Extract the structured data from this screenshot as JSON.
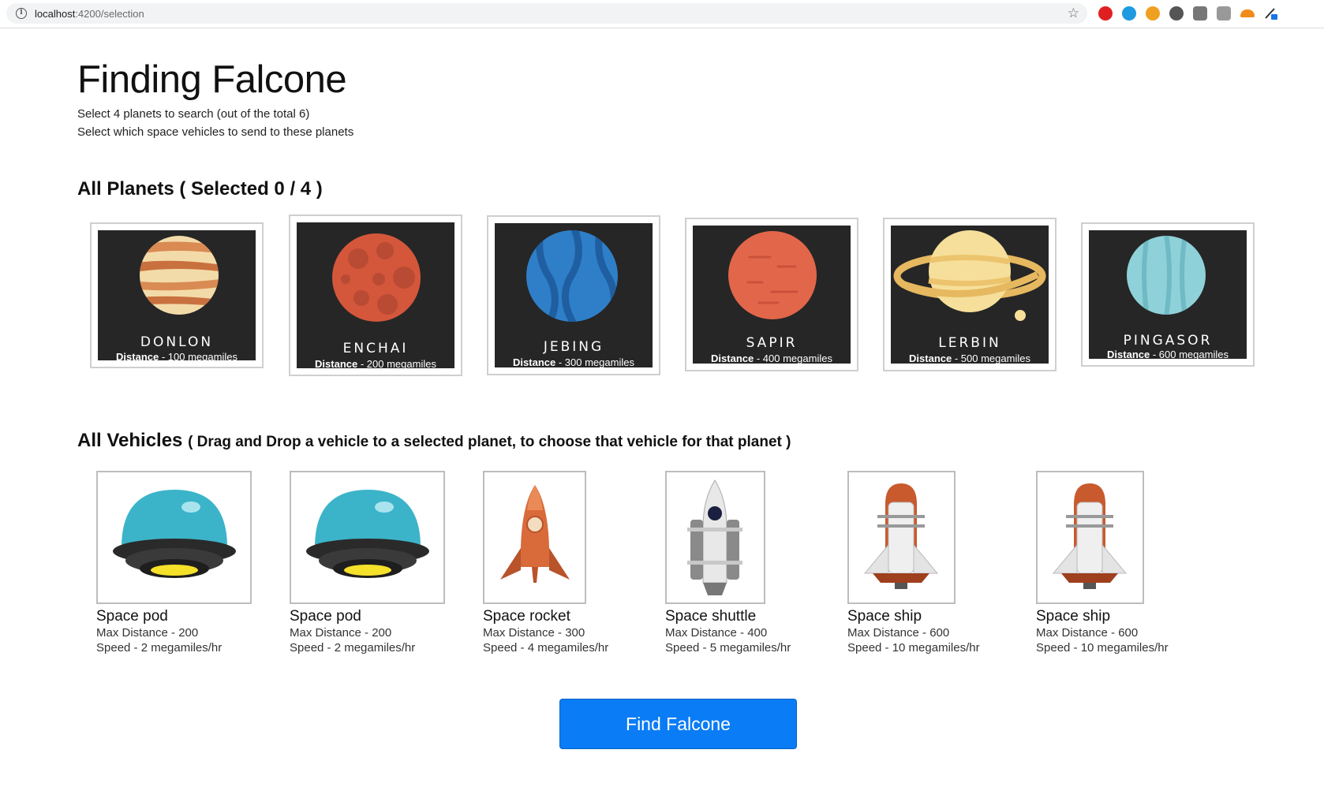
{
  "browser": {
    "url_host": "localhost",
    "url_rest": ":4200/selection"
  },
  "header": {
    "title": "Finding Falcone",
    "subtitle_1": "Select 4 planets to search (out of the total 6)",
    "subtitle_2": "Select which space vehicles to send to these planets"
  },
  "planets_section": {
    "heading": "All Planets ( Selected 0 / 4 )",
    "planets": [
      {
        "name": "DONLON",
        "distance_label": "Distance",
        "distance_value": "- 100 megamiles"
      },
      {
        "name": "ENCHAI",
        "distance_label": "Distance",
        "distance_value": "- 200 megamiles"
      },
      {
        "name": "JEBING",
        "distance_label": "Distance",
        "distance_value": "- 300 megamiles"
      },
      {
        "name": "SAPIR",
        "distance_label": "Distance",
        "distance_value": "- 400 megamiles"
      },
      {
        "name": "LERBIN",
        "distance_label": "Distance",
        "distance_value": "- 500 megamiles"
      },
      {
        "name": "PINGASOR",
        "distance_label": "Distance",
        "distance_value": "- 600 megamiles"
      }
    ]
  },
  "vehicles_section": {
    "heading": "All Vehicles",
    "hint": "( Drag and Drop a vehicle to a selected planet, to choose that vehicle for that planet )",
    "vehicles": [
      {
        "name": "Space pod",
        "max_distance": "Max Distance - 200",
        "speed": "Speed - 2 megamiles/hr"
      },
      {
        "name": "Space pod",
        "max_distance": "Max Distance - 200",
        "speed": "Speed - 2 megamiles/hr"
      },
      {
        "name": "Space rocket",
        "max_distance": "Max Distance - 300",
        "speed": "Speed - 4 megamiles/hr"
      },
      {
        "name": "Space shuttle",
        "max_distance": "Max Distance - 400",
        "speed": "Speed - 5 megamiles/hr"
      },
      {
        "name": "Space ship",
        "max_distance": "Max Distance - 600",
        "speed": "Speed - 10 megamiles/hr"
      },
      {
        "name": "Space ship",
        "max_distance": "Max Distance - 600",
        "speed": "Speed - 10 megamiles/hr"
      }
    ]
  },
  "actions": {
    "find_label": "Find Falcone"
  },
  "colors": {
    "accent": "#0a7cf5",
    "planet_bg": "#262626"
  }
}
